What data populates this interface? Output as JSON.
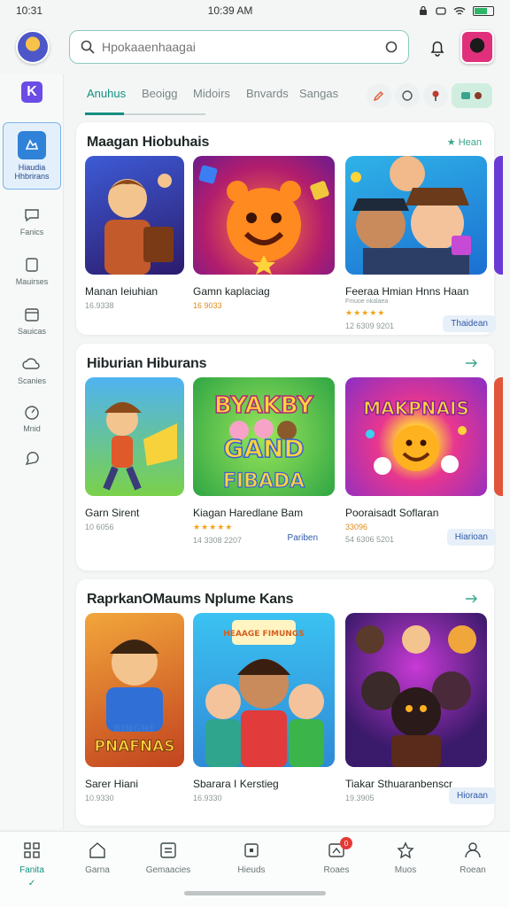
{
  "status": {
    "time": "10:31",
    "clock": "10:39 AM"
  },
  "search": {
    "placeholder": "Hpokaaenhaagai"
  },
  "tabs": [
    "Anuhus",
    "Beoigg",
    "Midoirs",
    "Bnvards",
    "Sangas"
  ],
  "sidebar": {
    "active_label_1": "Hiaudia",
    "active_label_2": "Hhbrirans",
    "items": [
      "Fanics",
      "Mauirses",
      "Sauicas",
      "Scanies",
      "Mnid"
    ]
  },
  "sections": [
    {
      "title": "Maagan Hiobuhais",
      "action": "★ Hean",
      "cards": [
        {
          "title": "Manan Ieiuhian",
          "meta": "16.9338"
        },
        {
          "title": "Gamn kaplaciag",
          "rating": "16 9033",
          "meta": ""
        },
        {
          "title": "Feeraa Hmian Hnns Haan",
          "sub": "Fmuoe nkalaea",
          "stars": "★★★★★",
          "meta": "12 6309 9201",
          "button": "Thaidean"
        }
      ]
    },
    {
      "title": "Hiburian Hiburans",
      "action": "",
      "cards": [
        {
          "title": "Garn Sirent",
          "meta": "10 6056"
        },
        {
          "title": "Kiagan Haredlane Bam",
          "stars": "★★★★★",
          "meta": "14 3308 2207",
          "button": "Pariben"
        },
        {
          "title": "Pooraisadt Soflaran",
          "rating": "33096",
          "meta": "54 6306 5201",
          "button": "Hiarioan"
        }
      ]
    },
    {
      "title": "RaprkanOMaums Nplume Kans",
      "action": "",
      "cards": [
        {
          "title": "Sarer Hiani",
          "meta": "10.9330"
        },
        {
          "title": "Sbarara I Kerstieg",
          "meta": "16.9330"
        },
        {
          "title": "Tiakar Sthuaranbenscr",
          "meta": "19.3905",
          "button": "Hioraan"
        }
      ]
    }
  ],
  "thumb_labels": {
    "candy_1": "BYAKBY",
    "candy_2": "GAND",
    "candy_3": "FIBADA",
    "makpnais": "MAKPNAIS",
    "pnafnas_1": "BINGNE",
    "pnafnas_2": "PNAFNAS",
    "banner": "HEAAGE FIMUNGS"
  },
  "bottom_nav": [
    {
      "label": "Fanita",
      "sub": "✓"
    },
    {
      "label": "Garna"
    },
    {
      "label": "Gemaacies"
    },
    {
      "label": "Hieuds"
    },
    {
      "label": "Roaes",
      "badge": "0"
    },
    {
      "label": "Muos"
    },
    {
      "label": "Roean"
    }
  ],
  "colors": {
    "accent": "#148f80",
    "active_sidebar": "#2f82d8",
    "star": "#f4a31c",
    "badge": "#e53935"
  }
}
